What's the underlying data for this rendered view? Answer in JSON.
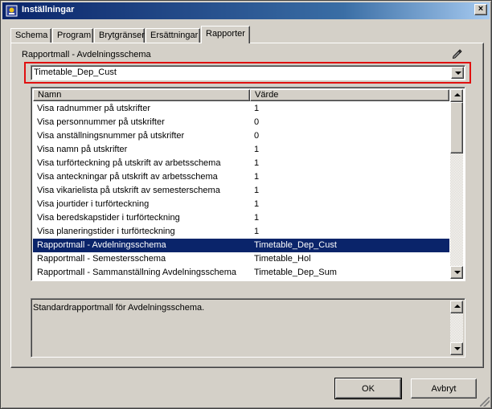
{
  "window": {
    "title": "Inställningar",
    "close_label": "×"
  },
  "tabs": [
    {
      "label": "Schema",
      "active": false
    },
    {
      "label": "Program",
      "active": false
    },
    {
      "label": "Brytgränser",
      "active": false
    },
    {
      "label": "Ersättningar",
      "active": false
    },
    {
      "label": "Rapporter",
      "active": true
    }
  ],
  "report_template": {
    "label": "Rapportmall - Avdelningsschema",
    "value": "Timetable_Dep_Cust",
    "edit_icon": "pencil-icon"
  },
  "table": {
    "columns": [
      "Namn",
      "Värde"
    ],
    "rows": [
      {
        "name": "Visa radnummer på utskrifter",
        "value": "1",
        "selected": false
      },
      {
        "name": "Visa personnummer på utskrifter",
        "value": "0",
        "selected": false
      },
      {
        "name": "Visa anställningsnummer på utskrifter",
        "value": "0",
        "selected": false
      },
      {
        "name": "Visa namn på utskrifter",
        "value": "1",
        "selected": false
      },
      {
        "name": "Visa turförteckning på utskrift av arbetsschema",
        "value": "1",
        "selected": false
      },
      {
        "name": "Visa anteckningar på utskrift av arbetsschema",
        "value": "1",
        "selected": false
      },
      {
        "name": "Visa vikarielista på utskrift av semesterschema",
        "value": "1",
        "selected": false
      },
      {
        "name": "Visa jourtider i turförteckning",
        "value": "1",
        "selected": false
      },
      {
        "name": "Visa beredskapstider i turförteckning",
        "value": "1",
        "selected": false
      },
      {
        "name": "Visa planeringstider i turförteckning",
        "value": "1",
        "selected": false
      },
      {
        "name": "Rapportmall - Avdelningsschema",
        "value": "Timetable_Dep_Cust",
        "selected": true
      },
      {
        "name": "Rapportmall - Semestersschema",
        "value": "Timetable_Hol",
        "selected": false
      },
      {
        "name": "Rapportmall - Sammanställning Avdelningsschema",
        "value": "Timetable_Dep_Sum",
        "selected": false
      }
    ]
  },
  "description": {
    "text": "Standardrapportmall för Avdelningsschema."
  },
  "buttons": {
    "ok_label": "OK",
    "cancel_label": "Avbryt"
  },
  "colors": {
    "selection": "#0a246a",
    "highlight_border": "#e01010",
    "face": "#d4d0c8"
  }
}
